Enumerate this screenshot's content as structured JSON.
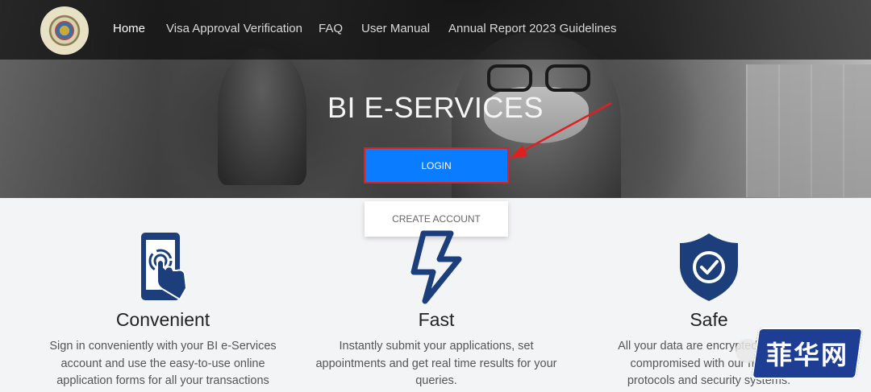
{
  "nav": {
    "items": [
      {
        "label": "Home",
        "active": true
      },
      {
        "label": "Visa Approval Verification"
      },
      {
        "label": "FAQ"
      },
      {
        "label": "User Manual"
      },
      {
        "label": "Annual Report 2023 Guidelines"
      }
    ]
  },
  "hero": {
    "title": "BI E-SERVICES",
    "login_label": "LOGIN",
    "create_label": "CREATE ACCOUNT"
  },
  "features": [
    {
      "title": "Convenient",
      "lines": [
        "Sign in conveniently with your BI e-Services",
        "account and use the easy-to-use online",
        "application forms for all your transactions"
      ],
      "icon": "touch-phone-icon"
    },
    {
      "title": "Fast",
      "lines": [
        "Instantly submit your applications, set",
        "appointments and get real time results for your",
        "queries."
      ],
      "icon": "lightning-icon"
    },
    {
      "title": "Safe",
      "lines": [
        "All your data are encrypted and not",
        "compromised with our modern",
        "protocols and security systems."
      ],
      "icon": "shield-check-icon"
    }
  ],
  "watermark": {
    "text": "菲华网"
  },
  "colors": {
    "accent": "#0a7cff",
    "icon": "#1c3f7c",
    "highlight": "#e02020"
  }
}
